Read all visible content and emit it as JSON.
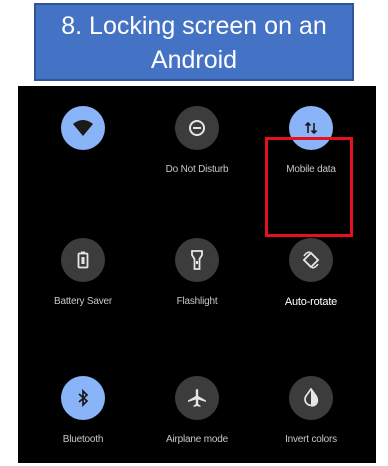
{
  "slide": {
    "title_line1": "8. Locking screen on an",
    "title_line2": "Android"
  },
  "quick_settings": {
    "tiles": [
      {
        "label": "",
        "icon": "wifi-icon",
        "active": true
      },
      {
        "label": "Do Not Disturb",
        "icon": "do-not-disturb-icon",
        "active": false
      },
      {
        "label": "Mobile data",
        "icon": "mobile-data-icon",
        "active": true
      },
      {
        "label": "Battery Saver",
        "icon": "battery-saver-icon",
        "active": false
      },
      {
        "label": "Flashlight",
        "icon": "flashlight-icon",
        "active": false
      },
      {
        "label": "Auto-rotate",
        "icon": "auto-rotate-icon",
        "active": false
      },
      {
        "label": "Bluetooth",
        "icon": "bluetooth-icon",
        "active": true
      },
      {
        "label": "Airplane mode",
        "icon": "airplane-icon",
        "active": false
      },
      {
        "label": "Invert colors",
        "icon": "invert-colors-icon",
        "active": false
      }
    ],
    "highlighted_tile": "Auto-rotate"
  },
  "colors": {
    "title_background": "#4472c4",
    "active_tile": "#8ab4f8",
    "inactive_tile": "#3c3c3c",
    "highlight_box": "#e8101c"
  }
}
